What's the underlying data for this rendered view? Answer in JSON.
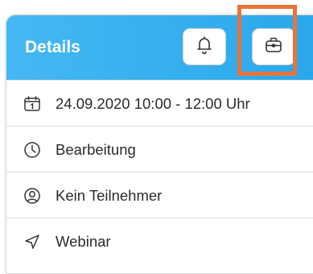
{
  "header": {
    "title": "Details",
    "bell_button_icon": "bell-icon",
    "briefcase_button_icon": "briefcase-icon"
  },
  "details": [
    {
      "icon": "calendar-icon",
      "text": "24.09.2020 10:00 - 12:00 Uhr"
    },
    {
      "icon": "clock-icon",
      "text": "Bearbeitung"
    },
    {
      "icon": "user-circle-icon",
      "text": "Kein Teilnehmer"
    },
    {
      "icon": "location-arrow-icon",
      "text": "Webinar"
    }
  ],
  "colors": {
    "header_gradient_start": "#45b8f2",
    "header_gradient_end": "#29a7eb",
    "highlight": "#e8743a"
  }
}
